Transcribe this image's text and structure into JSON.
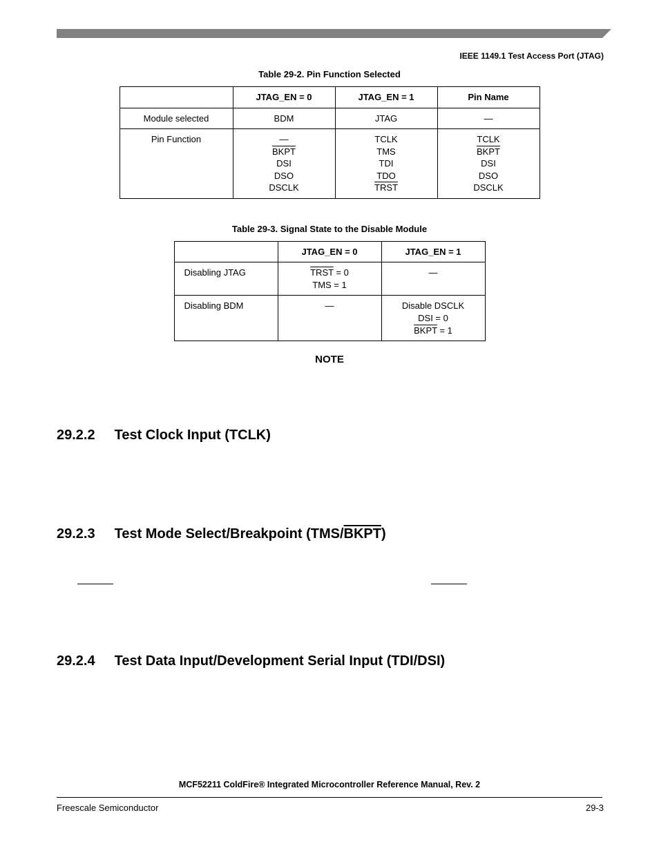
{
  "header": {
    "right": "IEEE 1149.1 Test Access Port (JTAG)"
  },
  "tables": {
    "t292": {
      "caption": "Table 29-2. Pin Function Selected",
      "headers": [
        "",
        "JTAG_EN = 0",
        "JTAG_EN = 1",
        "Pin Name"
      ],
      "rows": [
        {
          "label": "Module selected",
          "c1": [
            "BDM"
          ],
          "c2": [
            "JTAG"
          ],
          "c3": [
            "—"
          ]
        },
        {
          "label": "Pin Function",
          "c1": [
            "—",
            {
              "t": "BKPT",
              "o": true
            },
            "DSI",
            "DSO",
            "DSCLK"
          ],
          "c2": [
            "TCLK",
            "TMS",
            "TDI",
            "TDO",
            {
              "t": "TRST",
              "o": true
            }
          ],
          "c3": [
            "TCLK",
            {
              "t": "BKPT",
              "o": true
            },
            "DSI",
            "DSO",
            "DSCLK"
          ]
        }
      ]
    },
    "t293": {
      "caption": "Table 29-3. Signal State to the Disable Module",
      "headers": [
        "",
        "JTAG_EN = 0",
        "JTAG_EN = 1"
      ],
      "rows": [
        {
          "label": "Disabling JTAG",
          "c1": [
            {
              "t": "TRST",
              "o": true,
              "suffix": " = 0"
            },
            "TMS = 1"
          ],
          "c2": [
            "—"
          ]
        },
        {
          "label": "Disabling BDM",
          "c1": [
            "—"
          ],
          "c2": [
            "Disable DSCLK",
            "DSI = 0",
            {
              "t": "BKPT",
              "o": true,
              "suffix": " = 1"
            }
          ]
        }
      ]
    }
  },
  "note": "NOTE",
  "sections": {
    "s2922": {
      "num": "29.2.2",
      "title": "Test Clock Input (TCLK)"
    },
    "s2923": {
      "num": "29.2.3",
      "titlePre": "Test Mode Select/Breakpoint (TMS/",
      "titleOver": "BKPT",
      "titlePost": ")"
    },
    "s2924": {
      "num": "29.2.4",
      "title": "Test Data Input/Development Serial Input (TDI/DSI)"
    }
  },
  "footer": {
    "line1": "MCF52211 ColdFire® Integrated Microcontroller Reference Manual, Rev. 2",
    "left": "Freescale Semiconductor",
    "right": "29-3"
  }
}
